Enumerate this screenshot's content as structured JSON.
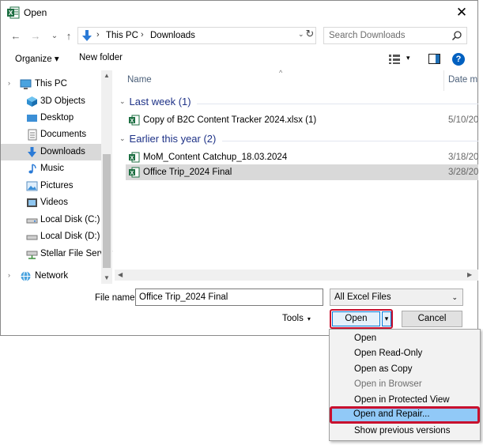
{
  "window": {
    "title": "Open",
    "close_glyph": "✕"
  },
  "nav": {
    "back_glyph": "←",
    "forward_glyph": "→",
    "recent_glyph": "⌄",
    "up_glyph": "↑"
  },
  "address": {
    "crumbs": [
      "This PC",
      "Downloads"
    ],
    "separator": "›",
    "dropdown_glyph": "⌄",
    "refresh_glyph": "↻"
  },
  "search": {
    "placeholder": "Search Downloads"
  },
  "toolbar": {
    "organize_label": "Organize ▾",
    "new_folder_label": "New folder",
    "view_dd_glyph": "▾",
    "help_glyph": "?"
  },
  "sidebar": {
    "items": [
      {
        "label": "This PC",
        "icon": "pc-icon"
      },
      {
        "label": "3D Objects",
        "icon": "cube-icon"
      },
      {
        "label": "Desktop",
        "icon": "desktop-icon"
      },
      {
        "label": "Documents",
        "icon": "documents-icon"
      },
      {
        "label": "Downloads",
        "icon": "download-icon"
      },
      {
        "label": "Music",
        "icon": "music-icon"
      },
      {
        "label": "Pictures",
        "icon": "pictures-icon"
      },
      {
        "label": "Videos",
        "icon": "videos-icon"
      },
      {
        "label": "Local Disk (C:)",
        "icon": "drive-icon"
      },
      {
        "label": "Local Disk (D:)",
        "icon": "drive-icon"
      },
      {
        "label": "Stellar File Server",
        "icon": "network-drive-icon"
      },
      {
        "label": "Network",
        "icon": "network-icon"
      }
    ],
    "selected": "Downloads",
    "caret_glyph": "›"
  },
  "filelist": {
    "columns": {
      "name": "Name",
      "date": "Date m"
    },
    "sort_glyph": "^",
    "groups": [
      {
        "label": "Last week (1)",
        "files": [
          {
            "name": "Copy of B2C Content Tracker 2024.xlsx (1)",
            "date": "5/10/20"
          }
        ]
      },
      {
        "label": "Earlier this year (2)",
        "files": [
          {
            "name": "MoM_Content Catchup_18.03.2024",
            "date": "3/18/20"
          },
          {
            "name": "Office Trip_2024 Final",
            "date": "3/28/20"
          }
        ]
      }
    ],
    "selected_file": "Office Trip_2024 Final",
    "group_chevron": "⌄"
  },
  "footer": {
    "file_name_label": "File name:",
    "file_name_value": "Office Trip_2024 Final",
    "filter_value": "All Excel Files",
    "tools_label": "Tools",
    "open_label": "Open",
    "cancel_label": "Cancel",
    "dd_glyph": "▾"
  },
  "open_menu": {
    "items": [
      {
        "label": "Open",
        "state": "enabled"
      },
      {
        "label": "Open Read-Only",
        "state": "enabled"
      },
      {
        "label": "Open as Copy",
        "state": "enabled"
      },
      {
        "label": "Open in Browser",
        "state": "disabled"
      },
      {
        "label": "Open in Protected View",
        "state": "enabled"
      },
      {
        "label": "Open and Repair...",
        "state": "highlighted"
      },
      {
        "label": "Show previous versions",
        "state": "enabled"
      }
    ]
  },
  "colors": {
    "excel_green": "#1d6f42",
    "highlight_red": "#c8102e",
    "selection_gray": "#d9d9d9",
    "menu_hover_blue": "#91c9f7",
    "group_header_blue": "#1e3287"
  }
}
